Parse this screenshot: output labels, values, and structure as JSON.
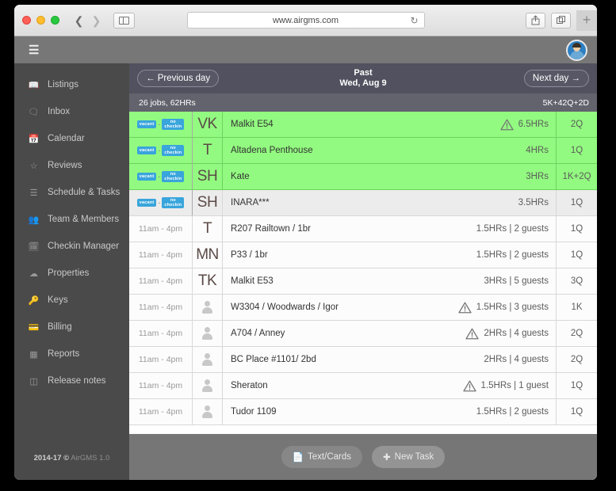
{
  "browser": {
    "url": "www.airgms.com",
    "back_icon": "chevron-left-icon",
    "forward_icon": "chevron-right-icon",
    "sidebar_icon": "sidebar-toggle-icon",
    "reload_icon": "reload-icon",
    "share_icon": "share-icon",
    "tabs_icon": "show-tabs-icon",
    "newtab_label": "+"
  },
  "topbar": {
    "menu_icon": "hamburger-menu-icon",
    "avatar_icon": "user-avatar-icon"
  },
  "sidebar": {
    "items": [
      {
        "label": "Listings",
        "icon": "book-icon"
      },
      {
        "label": "Inbox",
        "icon": "comments-icon"
      },
      {
        "label": "Calendar",
        "icon": "calendar-icon"
      },
      {
        "label": "Reviews",
        "icon": "star-icon"
      },
      {
        "label": "Schedule & Tasks",
        "icon": "list-icon"
      },
      {
        "label": "Team & Members",
        "icon": "users-icon"
      },
      {
        "label": "Checkin Manager",
        "icon": "calendar-check-icon"
      },
      {
        "label": "Properties",
        "icon": "network-icon"
      },
      {
        "label": "Keys",
        "icon": "key-icon"
      },
      {
        "label": "Billing",
        "icon": "credit-card-icon"
      },
      {
        "label": "Reports",
        "icon": "table-icon"
      },
      {
        "label": "Release notes",
        "icon": "notes-icon"
      }
    ],
    "copyright_bold": "2014-17 ©",
    "copyright_rest": "AirGMS 1.0"
  },
  "daynav": {
    "prev_label": "Previous day",
    "prev_icon": "arrow-left-icon",
    "next_label": "Next day",
    "next_icon": "arrow-right-icon",
    "status": "Past",
    "date": "Wed, Aug 9"
  },
  "summary": {
    "jobs": "26 jobs, 62HRs",
    "rooms": "5K+42Q+2D"
  },
  "badges": {
    "vacant": "vacant",
    "no": "no",
    "checkin": "checkin",
    "separator": "-"
  },
  "rows": [
    {
      "style": "green",
      "time_badges": true,
      "initials": "VK",
      "avatar": false,
      "name": "Malkit E54",
      "warn": true,
      "meta": "6.5HRs",
      "room": "2Q"
    },
    {
      "style": "green",
      "time_badges": true,
      "initials": "T",
      "avatar": false,
      "name": "Altadena Penthouse",
      "warn": false,
      "meta": "4HRs",
      "room": "1Q"
    },
    {
      "style": "green",
      "time_badges": true,
      "initials": "SH",
      "avatar": false,
      "name": "Kate",
      "warn": false,
      "meta": "3HRs",
      "room": "1K+2Q"
    },
    {
      "style": "gray",
      "time_badges": true,
      "initials": "SH",
      "avatar": false,
      "name": "INARA***",
      "warn": false,
      "meta": "3.5HRs",
      "room": "1Q"
    },
    {
      "style": "white",
      "time_badges": false,
      "time": "11am - 4pm",
      "initials": "T",
      "avatar": false,
      "name": "R207 Railtown / 1br",
      "warn": false,
      "meta": "1.5HRs | 2 guests",
      "room": "1Q"
    },
    {
      "style": "white",
      "time_badges": false,
      "time": "11am - 4pm",
      "initials": "MN",
      "avatar": false,
      "name": "P33 / 1br",
      "warn": false,
      "meta": "1.5HRs | 2 guests",
      "room": "1Q"
    },
    {
      "style": "white",
      "time_badges": false,
      "time": "11am - 4pm",
      "initials": "TK",
      "avatar": false,
      "name": "Malkit E53",
      "warn": false,
      "meta": "3HRs | 5 guests",
      "room": "3Q"
    },
    {
      "style": "white",
      "time_badges": false,
      "time": "11am - 4pm",
      "initials": "",
      "avatar": true,
      "name": "W3304 / Woodwards / Igor",
      "warn": true,
      "meta": "1.5HRs | 3 guests",
      "room": "1K"
    },
    {
      "style": "white",
      "time_badges": false,
      "time": "11am - 4pm",
      "initials": "",
      "avatar": true,
      "name": "A704 / Anney",
      "warn": true,
      "meta": "2HRs | 4 guests",
      "room": "2Q"
    },
    {
      "style": "white",
      "time_badges": false,
      "time": "11am - 4pm",
      "initials": "",
      "avatar": true,
      "name": "BC Place #1101/ 2bd",
      "warn": false,
      "meta": "2HRs | 4 guests",
      "room": "2Q"
    },
    {
      "style": "white",
      "time_badges": false,
      "time": "11am - 4pm",
      "initials": "",
      "avatar": true,
      "name": "Sheraton",
      "warn": true,
      "meta": "1.5HRs | 1 guest",
      "room": "1Q"
    },
    {
      "style": "white",
      "time_badges": false,
      "time": "11am - 4pm",
      "initials": "",
      "avatar": true,
      "name": "Tudor 1109",
      "warn": false,
      "meta": "1.5HRs | 2 guests",
      "room": "1Q"
    }
  ],
  "footer": {
    "text_cards_label": "Text/Cards",
    "text_cards_icon": "document-icon",
    "new_task_label": "New Task",
    "new_task_icon": "plus-square-icon"
  },
  "colors": {
    "green_row": "#92fa80",
    "badge_blue": "#39a5dc",
    "daynav": "#51515f",
    "topbar": "#777777",
    "sidebar": "#4a4a4a"
  }
}
